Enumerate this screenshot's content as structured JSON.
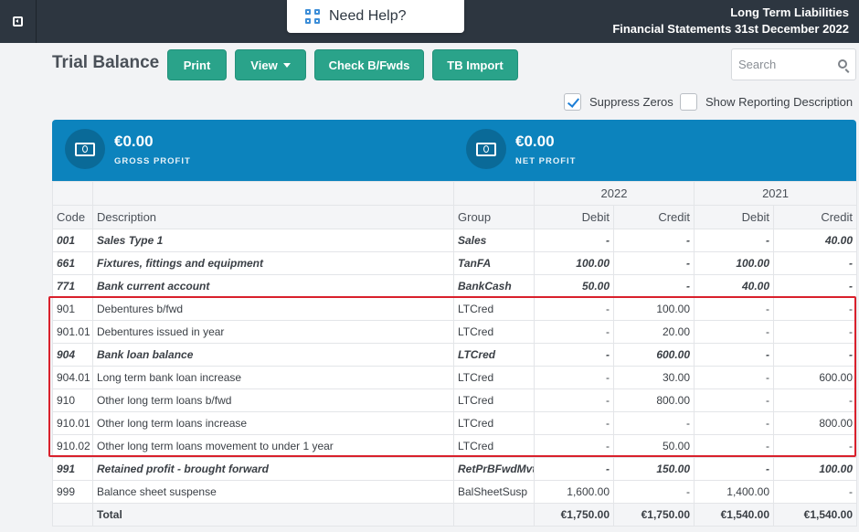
{
  "header": {
    "help_label": "Need Help?",
    "title_line1": "Long Term Liabilities",
    "title_line2": "Financial Statements 31st December 2022"
  },
  "toolbar": {
    "page_title": "Trial Balance",
    "print_label": "Print",
    "view_label": "View",
    "check_label": "Check B/Fwds",
    "import_label": "TB Import",
    "search_placeholder": "Search"
  },
  "options": {
    "suppress_zeros": {
      "label": "Suppress Zeros",
      "checked": true
    },
    "show_reporting": {
      "label": "Show Reporting Description",
      "checked": false
    }
  },
  "summary": {
    "gross_profit": {
      "value": "€0.00",
      "label": "GROSS PROFIT"
    },
    "net_profit": {
      "value": "€0.00",
      "label": "NET PROFIT"
    }
  },
  "table": {
    "years": [
      "2022",
      "2021"
    ],
    "columns": [
      "Code",
      "Description",
      "Group",
      "Debit",
      "Credit",
      "Debit",
      "Credit"
    ],
    "rows": [
      {
        "code": "001",
        "desc": "Sales Type 1",
        "group": "Sales",
        "d1": "-",
        "c1": "-",
        "d2": "-",
        "c2": "40.00",
        "bold": true
      },
      {
        "code": "661",
        "desc": "Fixtures, fittings and equipment",
        "group": "TanFA",
        "d1": "100.00",
        "c1": "-",
        "d2": "100.00",
        "c2": "-",
        "bold": true
      },
      {
        "code": "771",
        "desc": "Bank current account",
        "group": "BankCash",
        "d1": "50.00",
        "c1": "-",
        "d2": "40.00",
        "c2": "-",
        "bold": true
      },
      {
        "code": "901",
        "desc": "Debentures b/fwd",
        "group": "LTCred",
        "d1": "-",
        "c1": "100.00",
        "d2": "-",
        "c2": "-",
        "bold": false
      },
      {
        "code": "901.01",
        "desc": "Debentures issued in year",
        "group": "LTCred",
        "d1": "-",
        "c1": "20.00",
        "d2": "-",
        "c2": "-",
        "bold": false
      },
      {
        "code": "904",
        "desc": "Bank loan balance",
        "group": "LTCred",
        "d1": "-",
        "c1": "600.00",
        "d2": "-",
        "c2": "-",
        "bold": true
      },
      {
        "code": "904.01",
        "desc": "Long term bank loan increase",
        "group": "LTCred",
        "d1": "-",
        "c1": "30.00",
        "d2": "-",
        "c2": "600.00",
        "bold": false
      },
      {
        "code": "910",
        "desc": "Other long term loans b/fwd",
        "group": "LTCred",
        "d1": "-",
        "c1": "800.00",
        "d2": "-",
        "c2": "-",
        "bold": false
      },
      {
        "code": "910.01",
        "desc": "Other long term loans increase",
        "group": "LTCred",
        "d1": "-",
        "c1": "-",
        "d2": "-",
        "c2": "800.00",
        "bold": false
      },
      {
        "code": "910.02",
        "desc": "Other long term loans movement to under 1 year",
        "group": "LTCred",
        "d1": "-",
        "c1": "50.00",
        "d2": "-",
        "c2": "-",
        "bold": false
      },
      {
        "code": "991",
        "desc": "Retained profit - brought forward",
        "group": "RetPrBFwdMvt",
        "d1": "-",
        "c1": "150.00",
        "d2": "-",
        "c2": "100.00",
        "bold": true
      },
      {
        "code": "999",
        "desc": "Balance sheet suspense",
        "group": "BalSheetSusp",
        "d1": "1,600.00",
        "c1": "-",
        "d2": "1,400.00",
        "c2": "-",
        "bold": false
      }
    ],
    "total": {
      "label": "Total",
      "d1": "€1,750.00",
      "c1": "€1,750.00",
      "d2": "€1,540.00",
      "c2": "€1,540.00"
    }
  },
  "colors": {
    "primary_button": "#2aa38a",
    "banner": "#0c83bd",
    "topbar": "#2d3640",
    "highlight": "#d9202c"
  }
}
